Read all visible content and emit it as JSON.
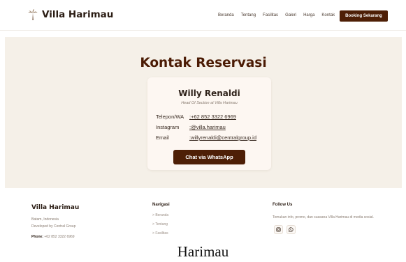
{
  "header": {
    "brand": "Villa Harimau",
    "nav": [
      "Beranda",
      "Tentang",
      "Fasilitas",
      "Galeri",
      "Harga",
      "Kontak"
    ],
    "cta": "Booking Sekarang"
  },
  "contact": {
    "title": "Kontak Reservasi",
    "name": "Willy Renaldi",
    "role": "Head Of Section at Villa Harimau",
    "rows": [
      {
        "label": "Telepon/WA",
        "value": "+62 852 3322 6969"
      },
      {
        "label": "Instagram",
        "value": "@villa.harimau"
      },
      {
        "label": "Email",
        "value": "willyrenaldi@centralgroup.id"
      }
    ],
    "button": "Chat via WhatsApp"
  },
  "footer": {
    "brand": "Villa Harimau",
    "location": "Batam, Indonesia",
    "developer": "Developed by Central Group",
    "phone_label": "Phone:",
    "phone": "+62 852 3322 6969",
    "nav_heading": "Navigasi",
    "nav_items": [
      "Beranda",
      "Tentang",
      "Fasilitas"
    ],
    "follow_heading": "Follow Us",
    "follow_text": "Temukan info, promo, dan suasana Villa Harimau di media sosial.",
    "social_icons": [
      "instagram-icon",
      "whatsapp-icon"
    ]
  },
  "caption": "Harimau",
  "colors": {
    "accent": "#4e1f06",
    "section_bg": "#f5f0e8",
    "card_bg": "#fdf7f2"
  }
}
